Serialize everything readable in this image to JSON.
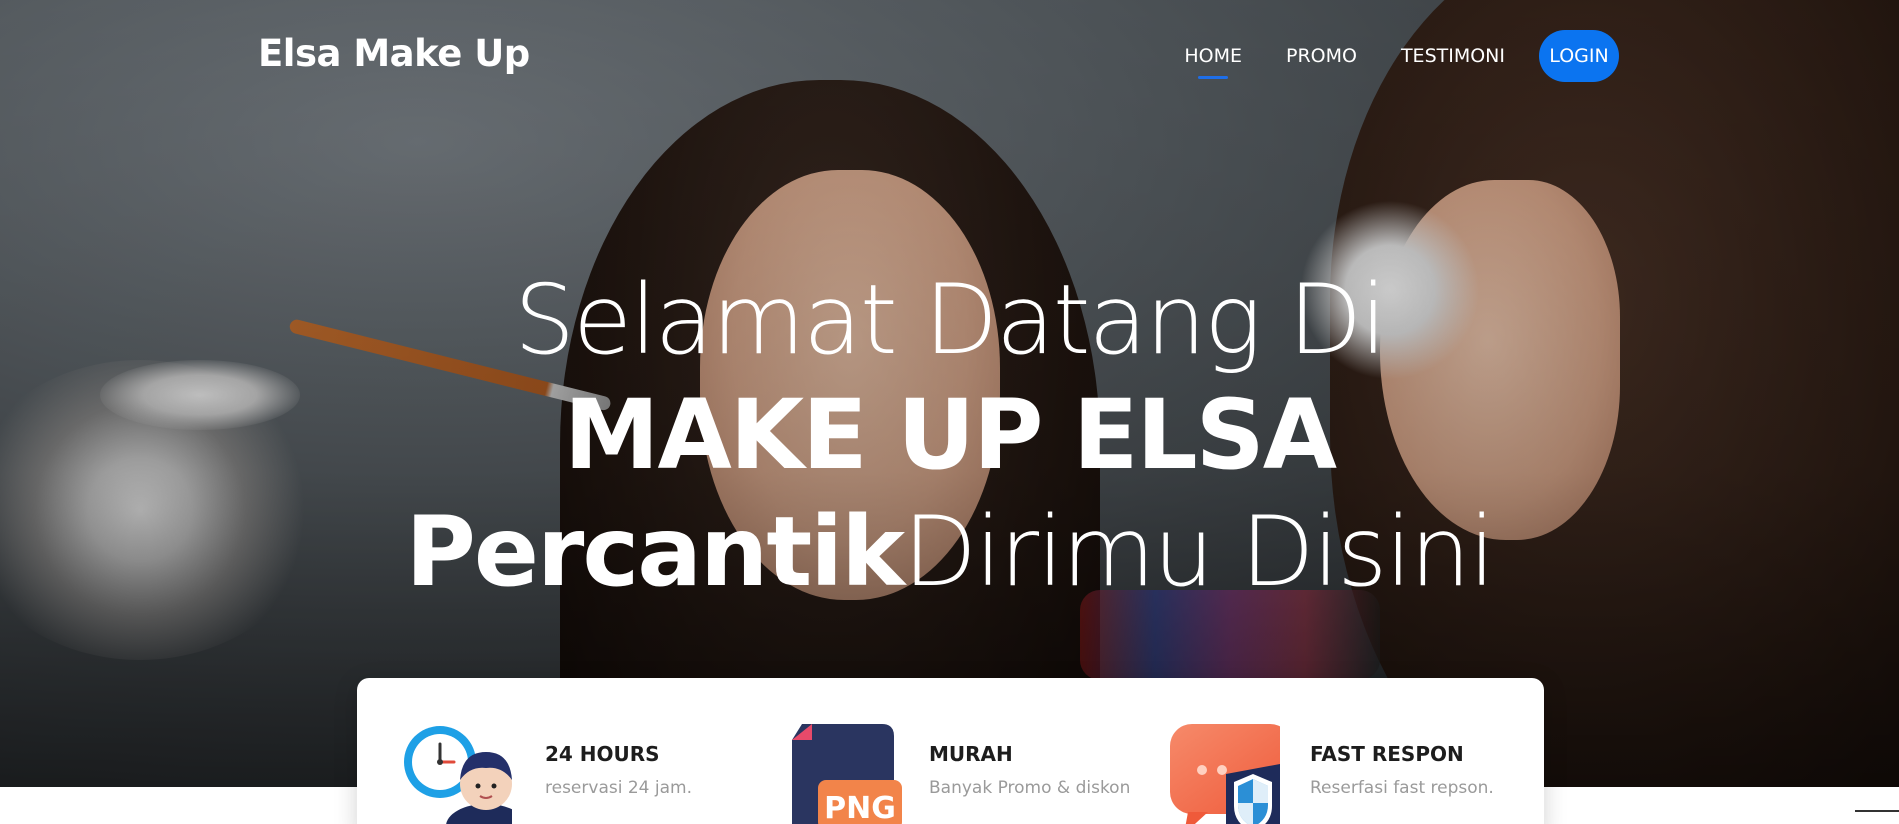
{
  "navbar": {
    "brand": "Elsa Make Up",
    "links": [
      {
        "label": "HOME",
        "active": true
      },
      {
        "label": "PROMO",
        "active": false
      },
      {
        "label": "TESTIMONI",
        "active": false
      }
    ],
    "login_label": "LOGIN"
  },
  "hero": {
    "line1": "Selamat Datang Di",
    "line2": "MAKE UP ELSA",
    "line3_bold": "Percantik",
    "line3_light": "Dirimu Disini"
  },
  "features": [
    {
      "title": "24 HOURS",
      "desc": "reservasi 24 jam.",
      "icon": "clock-support-icon"
    },
    {
      "title": "MURAH",
      "desc": "Banyak Promo & diskon",
      "icon": "png-file-icon"
    },
    {
      "title": "FAST RESPON",
      "desc": "Reserfasi fast repson.",
      "icon": "chat-shield-icon"
    }
  ],
  "colors": {
    "accent": "#0b74f0",
    "nav_underline": "#1e6ee8",
    "feature_title": "#1d1d1d",
    "feature_desc": "#9a9a9a"
  }
}
